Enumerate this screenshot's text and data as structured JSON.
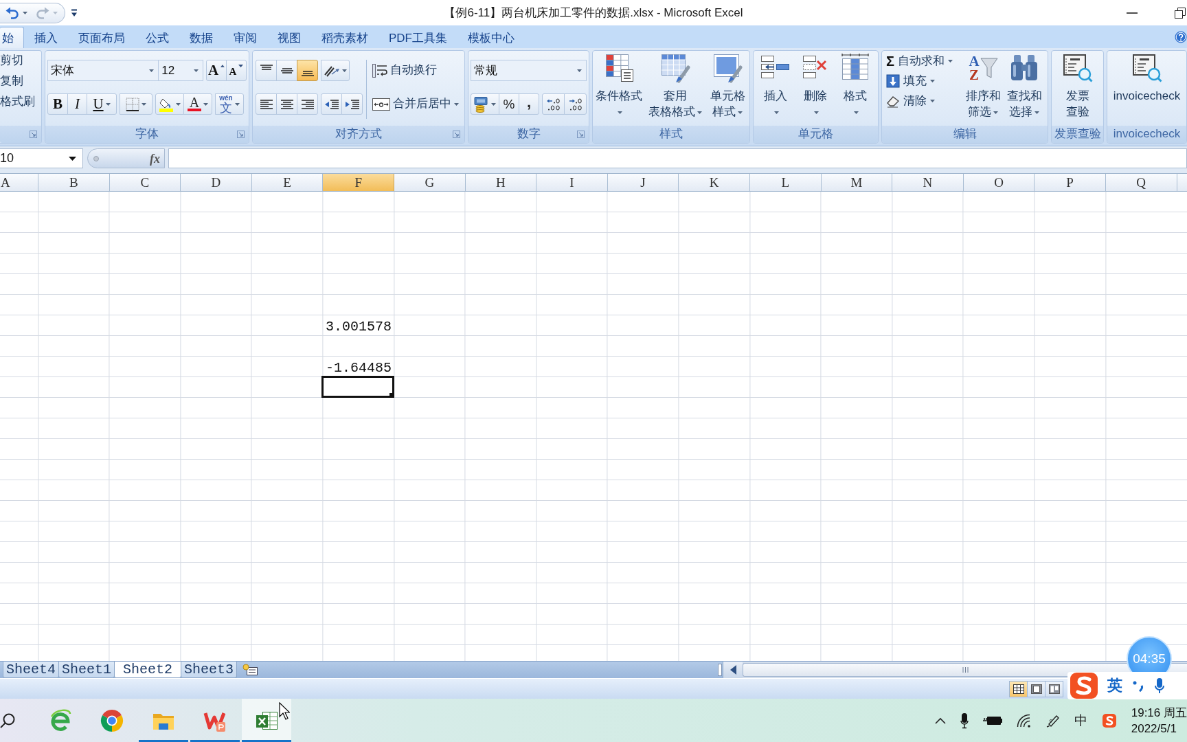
{
  "window": {
    "title": "【例6-11】两台机床加工零件的数据.xlsx - Microsoft Excel"
  },
  "quick_access": [
    {
      "kind": "undo",
      "disabled": false
    },
    {
      "kind": "redo",
      "disabled": true
    }
  ],
  "ribbon_tabs": [
    {
      "label": "始",
      "selected": true
    },
    {
      "label": "插入",
      "selected": false
    },
    {
      "label": "页面布局",
      "selected": false
    },
    {
      "label": "公式",
      "selected": false
    },
    {
      "label": "数据",
      "selected": false
    },
    {
      "label": "审阅",
      "selected": false
    },
    {
      "label": "视图",
      "selected": false
    },
    {
      "label": "稻壳素材",
      "selected": false
    },
    {
      "label": "PDF工具集",
      "selected": false
    },
    {
      "label": "模板中心",
      "selected": false
    }
  ],
  "ribbon": {
    "clipboard": {
      "items": [
        "剪切",
        "复制",
        "格式刷"
      ]
    },
    "font": {
      "label": "字体",
      "font_name": "宋体",
      "font_size": "12",
      "size_buttons": [
        "A",
        "A"
      ],
      "style_buttons": [
        "B",
        "I",
        "U"
      ],
      "font_color": "A",
      "phonetic": {
        "ruby": "wén",
        "glyph": "文"
      }
    },
    "alignment": {
      "label": "对齐方式",
      "vertical": [
        {
          "selected": false
        },
        {
          "selected": false
        },
        {
          "selected": true
        }
      ],
      "horizontal": [
        {
          "selected": false
        },
        {
          "selected": false
        },
        {
          "selected": false
        }
      ],
      "wrap_text": "自动换行",
      "merge_center": "合并后居中"
    },
    "number": {
      "label": "数字",
      "format": "常规",
      "percent": "%",
      "comma": ","
    },
    "styles": {
      "label": "样式",
      "buttons": [
        {
          "kind": "conditional",
          "lines": [
            "条件格式"
          ],
          "dropdown": true
        },
        {
          "kind": "table",
          "lines": [
            "套用",
            "表格格式"
          ],
          "dropdown": true
        },
        {
          "kind": "cellstyle",
          "lines": [
            "单元格",
            "样式"
          ],
          "dropdown": true
        }
      ]
    },
    "cells": {
      "label": "单元格",
      "buttons": [
        {
          "kind": "insert",
          "lines": [
            "插入"
          ],
          "dropdown": true
        },
        {
          "kind": "delete",
          "lines": [
            "删除"
          ],
          "dropdown": true
        },
        {
          "kind": "format",
          "lines": [
            "格式"
          ],
          "dropdown": true
        }
      ]
    },
    "editing": {
      "label": "编辑",
      "small": [
        {
          "kind": "sum",
          "symbol": "Σ",
          "label": "自动求和"
        },
        {
          "kind": "fill",
          "label": "填充"
        },
        {
          "kind": "clear",
          "label": "清除"
        }
      ],
      "large": [
        {
          "kind": "sort",
          "letters": [
            "A",
            "Z"
          ],
          "lines": [
            "排序和",
            "筛选"
          ],
          "dropdown": true
        },
        {
          "kind": "find",
          "lines": [
            "查找和",
            "选择"
          ],
          "dropdown": true
        }
      ]
    },
    "invoice": {
      "label": "发票查验",
      "buttons": [
        {
          "kind": "invoice",
          "lines": [
            "发票",
            "查验"
          ],
          "dropdown": false
        }
      ]
    },
    "invoicecheck": {
      "label": "invoicecheck",
      "buttons": [
        {
          "kind": "invoice",
          "lines": [
            "invoicecheck"
          ],
          "dropdown": false
        }
      ]
    }
  },
  "formula_bar": {
    "name_box": "10",
    "function_button": "fx"
  },
  "columns": [
    {
      "label": "A",
      "selected": false
    },
    {
      "label": "B",
      "selected": false
    },
    {
      "label": "C",
      "selected": false
    },
    {
      "label": "D",
      "selected": false
    },
    {
      "label": "E",
      "selected": false
    },
    {
      "label": "F",
      "selected": true
    },
    {
      "label": "G",
      "selected": false
    },
    {
      "label": "H",
      "selected": false
    },
    {
      "label": "I",
      "selected": false
    },
    {
      "label": "J",
      "selected": false
    },
    {
      "label": "K",
      "selected": false
    },
    {
      "label": "L",
      "selected": false
    },
    {
      "label": "M",
      "selected": false
    },
    {
      "label": "N",
      "selected": false
    },
    {
      "label": "O",
      "selected": false
    },
    {
      "label": "P",
      "selected": false
    },
    {
      "label": "Q",
      "selected": false
    }
  ],
  "sheet": {
    "cells": [
      {
        "value": "3.001578",
        "selected": false
      },
      {
        "value": "-1.64485",
        "selected": false
      },
      {
        "selected": true
      }
    ]
  },
  "sheet_tabs": [
    {
      "label": "Sheet4",
      "selected": false
    },
    {
      "label": "Sheet1",
      "selected": false
    },
    {
      "label": "Sheet2",
      "selected": true
    },
    {
      "label": "Sheet3",
      "selected": false
    }
  ],
  "status_bar": {
    "views": [
      {
        "kind": "normal",
        "selected": true
      },
      {
        "kind": "page_layout",
        "selected": false
      },
      {
        "kind": "page_break",
        "selected": false
      }
    ]
  },
  "timer": {
    "text": "04:35"
  },
  "ime_toolbar": {
    "mode": "英"
  },
  "taskbar": {
    "apps": [
      {
        "kind": "browser_e",
        "running": false,
        "selected": false
      },
      {
        "kind": "browser_round",
        "running": false,
        "selected": false
      },
      {
        "kind": "folder",
        "running": true,
        "selected": false
      },
      {
        "kind": "pdf",
        "running": true,
        "selected": false
      },
      {
        "kind": "spreadsheet",
        "running": true,
        "selected": true
      }
    ],
    "tray": {
      "ime": "中",
      "time": "19:16 周五",
      "date": "2022/5/1"
    }
  }
}
